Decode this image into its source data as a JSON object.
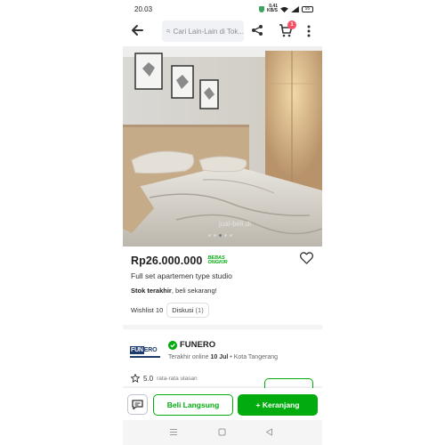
{
  "status_bar": {
    "time": "20.03",
    "net_speed_value": "0,41",
    "net_speed_unit": "KB/S",
    "battery": "95"
  },
  "header": {
    "search_placeholder": "Cari Lain-Lain di Tok...",
    "cart_badge": "1"
  },
  "product": {
    "price": "Rp26.000.000",
    "shipping_badge_line1": "BEBAS",
    "shipping_badge_line2": "ONGKIR",
    "title": "Full set apartemen type studio",
    "stock_bold": "Stok terakhir",
    "stock_rest": ", beli sekarang!",
    "wishlist": "Wishlist 10",
    "discussion_label": "Diskusi",
    "discussion_count": "(1)",
    "image_watermark": "jual-beli.di"
  },
  "shop": {
    "logo_text_a": "FUN",
    "logo_text_b": "ERO",
    "name": "FUNERO",
    "last_online_prefix": "Terakhir online",
    "last_online_date": "10 Jul",
    "location": "• Kota Tangerang",
    "rating": "5.0",
    "rating_label": "rata-rata ulasan"
  },
  "actions": {
    "buy_now": "Beli Langsung",
    "add_to_cart": "+ Keranjang"
  },
  "colors": {
    "brand_green": "#03ac0e",
    "badge_red": "#f94d63"
  },
  "icons": [
    "back-arrow-icon",
    "search-icon",
    "share-icon",
    "cart-icon",
    "kebab-menu-icon",
    "heart-icon",
    "star-icon",
    "chat-icon",
    "official-store-badge-icon",
    "menu-nav-icon",
    "home-nav-icon",
    "back-nav-icon"
  ]
}
